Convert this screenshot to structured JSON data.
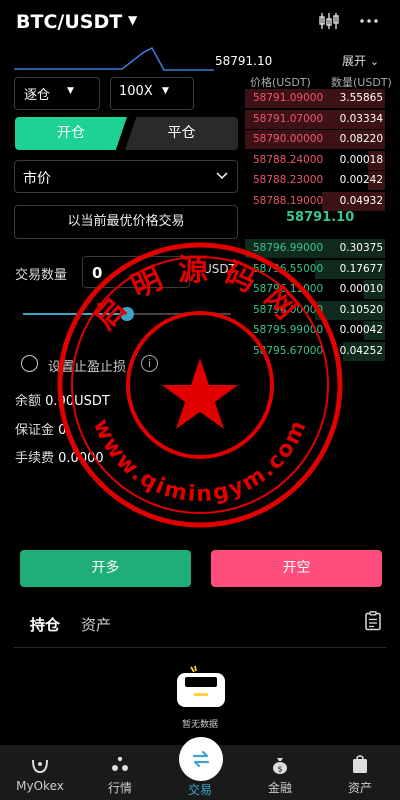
{
  "header": {
    "pair": "BTC/USDT",
    "chart_icon": "candlestick-settings-icon",
    "more_icon": "more-dots-icon"
  },
  "ticker": {
    "last_price": "58791.10",
    "expand_label": "展开"
  },
  "order_form": {
    "margin_mode": "逐仓",
    "leverage": "100X",
    "open_tab": "开仓",
    "close_tab": "平仓",
    "order_type": "市价",
    "best_price_label": "以当前最优价格交易",
    "quantity_label": "交易数量",
    "quantity_value": "0",
    "quantity_unit": "USDT",
    "slider_percent": 50,
    "tpsl_label": "设置止盈止损",
    "balance_label": "余额",
    "balance_value": "0.00USDT",
    "margin_label": "保证金",
    "margin_value": "0",
    "fee_label": "手续费",
    "fee_value": "0.0000"
  },
  "order_book": {
    "price_header": "价格(USDT)",
    "qty_header": "数量(USDT)",
    "asks": [
      {
        "price": "58791.09000",
        "qty": "3.55865",
        "depth": 1.0
      },
      {
        "price": "58791.07000",
        "qty": "0.03334",
        "depth": 1.0
      },
      {
        "price": "58790.00000",
        "qty": "0.08220",
        "depth": 1.0
      },
      {
        "price": "58788.24000",
        "qty": "0.00018",
        "depth": 0.12
      },
      {
        "price": "58788.23000",
        "qty": "0.00242",
        "depth": 0.12
      },
      {
        "price": "58788.19000",
        "qty": "0.04932",
        "depth": 0.45
      }
    ],
    "mid_price": "58791.10",
    "bids": [
      {
        "price": "58796.99000",
        "qty": "0.30375",
        "depth": 1.0
      },
      {
        "price": "58796.55000",
        "qty": "0.17677",
        "depth": 0.5
      },
      {
        "price": "58796.11000",
        "qty": "0.00010",
        "depth": 0.15
      },
      {
        "price": "58796.00000",
        "qty": "0.10520",
        "depth": 0.5
      },
      {
        "price": "58795.99000",
        "qty": "0.00042",
        "depth": 0.15
      },
      {
        "price": "58795.67000",
        "qty": "0.04252",
        "depth": 0.3
      }
    ]
  },
  "actions": {
    "long_label": "开多",
    "short_label": "开空"
  },
  "positions": {
    "tab_positions": "持仓",
    "tab_assets": "资产",
    "empty_text": "暂无数据"
  },
  "tabbar": {
    "items": [
      {
        "label": "MyOkex",
        "icon": "myokex-icon"
      },
      {
        "label": "行情",
        "icon": "market-icon"
      },
      {
        "label": "交易",
        "icon": "trade-icon"
      },
      {
        "label": "金融",
        "icon": "finance-icon"
      },
      {
        "label": "资产",
        "icon": "assets-icon"
      }
    ]
  },
  "watermark": {
    "top_text": "启明源码网",
    "bottom_text": "www.qimingym.com"
  },
  "colors": {
    "green": "#1ed197",
    "red": "#ff4e7c",
    "accent": "#3aa6c8",
    "ask_text": "#f0556e",
    "bid_text": "#37c78c"
  }
}
